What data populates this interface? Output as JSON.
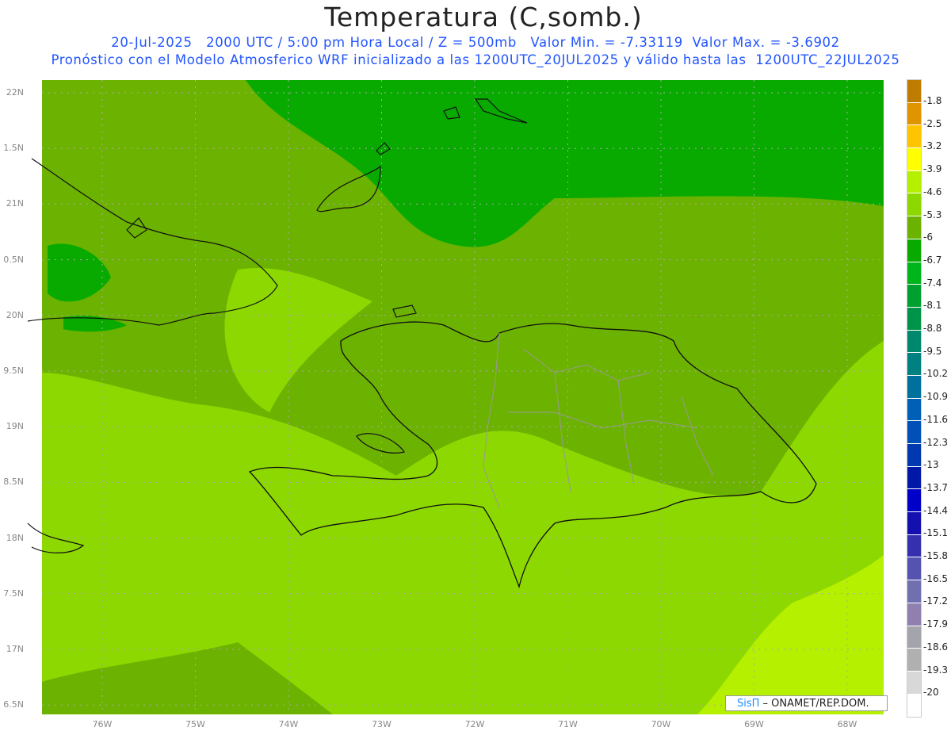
{
  "header": {
    "title": "Temperatura (C,somb.)",
    "line1": "20-Jul-2025   2000 UTC / 5:00 pm Hora Local / Z = 500mb   Valor Min. = -7.33119  Valor Max. = -3.6902",
    "line2": "Pronóstico con el Modelo Atmosferico WRF inicializado a las 1200UTC_20JUL2025 y válido hasta las  1200UTC_22JUL2025"
  },
  "axes": {
    "lat_labels": [
      "22N",
      "1.5N",
      "21N",
      "0.5N",
      "20N",
      "9.5N",
      "19N",
      "8.5N",
      "18N",
      "7.5N",
      "17N",
      "6.5N"
    ],
    "lon_labels": [
      "76W",
      "75W",
      "74W",
      "73W",
      "72W",
      "71W",
      "70W",
      "69W",
      "68W"
    ]
  },
  "colorbar": {
    "labels": [
      "-1.8",
      "-2.5",
      "-3.2",
      "-3.9",
      "-4.6",
      "-5.3",
      "-6",
      "-6.7",
      "-7.4",
      "-8.1",
      "-8.8",
      "-9.5",
      "-10.2",
      "-10.9",
      "-11.6",
      "-12.3",
      "-13",
      "-13.7",
      "-14.4",
      "-15.1",
      "-15.8",
      "-16.5",
      "-17.2",
      "-17.9",
      "-18.6",
      "-19.3",
      "-20"
    ],
    "colors": [
      "#c07c00",
      "#e09400",
      "#ffc400",
      "#ffff00",
      "#b4f000",
      "#8cd800",
      "#6cb200",
      "#08aa00",
      "#00b41c",
      "#00a030",
      "#009448",
      "#00886c",
      "#008080",
      "#00709c",
      "#0060b8",
      "#0050b8",
      "#0038b0",
      "#0018a8",
      "#0000c8",
      "#1410b0",
      "#3430b0",
      "#5454b0",
      "#7070b0",
      "#9080b0",
      "#a4a4ac",
      "#b0b0b0",
      "#d8d8d8",
      "#ffffff"
    ]
  },
  "credit": {
    "brand": "SisΠ",
    "text": " – ONAMET/REP.DOM."
  }
}
